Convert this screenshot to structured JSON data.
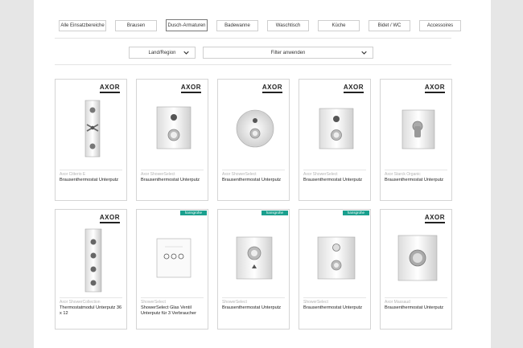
{
  "tabs": [
    {
      "label": "Alle Einsatzbereiche",
      "active": false
    },
    {
      "label": "Brausen",
      "active": false
    },
    {
      "label": "Dusch-Armaturen",
      "active": true
    },
    {
      "label": "Badewanne",
      "active": false
    },
    {
      "label": "Waschtisch",
      "active": false
    },
    {
      "label": "Küche",
      "active": false
    },
    {
      "label": "Bidet / WC",
      "active": false
    },
    {
      "label": "Accessoires",
      "active": false
    }
  ],
  "filters": {
    "region_label": "Land/Region",
    "filter_label": "Filter anwenden"
  },
  "products": [
    {
      "brand": "AXOR",
      "badge": "",
      "series": "Axor Citterio E",
      "name": "Brausenthermostat Unterputz",
      "image": "tall-panel-cross"
    },
    {
      "brand": "AXOR",
      "badge": "",
      "series": "Axor ShowerSelect",
      "name": "Brausenthermostat Unterputz",
      "image": "square-button-knob"
    },
    {
      "brand": "AXOR",
      "badge": "",
      "series": "Axor ShowerSelect",
      "name": "Brausenthermostat Unterputz",
      "image": "round-button-knob"
    },
    {
      "brand": "AXOR",
      "badge": "",
      "series": "Axor ShowerSelect",
      "name": "Brausenthermostat Unterputz",
      "image": "square-button-knob-2"
    },
    {
      "brand": "AXOR",
      "badge": "",
      "series": "Axor Starck Organic",
      "name": "Brausenthermostat Unterputz",
      "image": "square-knob"
    },
    {
      "brand": "AXOR",
      "badge": "",
      "series": "Axor ShowerCollection",
      "name": "Thermostatmodul Unterputz 36 x 12",
      "image": "tall-panel-knobs"
    },
    {
      "brand": "",
      "badge": "hansgrohe",
      "series": "ShowerSelect",
      "name": "ShowerSelect Glas Ventil Unterputz für 3 Verbraucher",
      "image": "glass-panel-three"
    },
    {
      "brand": "",
      "badge": "hansgrohe",
      "series": "ShowerSelect",
      "name": "Brausenthermostat Unterputz",
      "image": "square-knob-button"
    },
    {
      "brand": "",
      "badge": "hansgrohe",
      "series": "ShowerSelect",
      "name": "Brausenthermostat Unterputz",
      "image": "square-dial-knob"
    },
    {
      "brand": "AXOR",
      "badge": "",
      "series": "Axor Massaud",
      "name": "Brausenthermostat Unterputz",
      "image": "square-knob-large"
    }
  ]
}
